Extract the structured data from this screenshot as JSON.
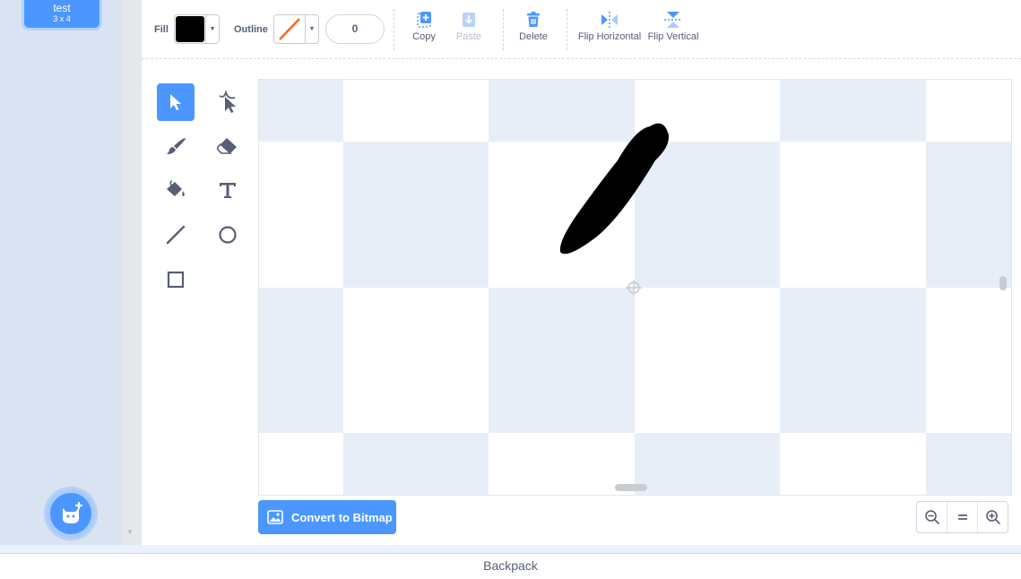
{
  "costume": {
    "name": "test",
    "size": "3 x 4"
  },
  "toolbar": {
    "fill_label": "Fill",
    "fill_color": "#000000",
    "outline_label": "Outline",
    "outline_width": "0",
    "copy_label": "Copy",
    "paste_label": "Paste",
    "delete_label": "Delete",
    "flip_horizontal_label": "Flip Horizontal",
    "flip_vertical_label": "Flip Vertical"
  },
  "tools": [
    "select",
    "reshape",
    "brush",
    "eraser",
    "fill",
    "text",
    "line",
    "circle",
    "rectangle"
  ],
  "active_tool": "select",
  "convert_label": "Convert to Bitmap",
  "backpack_label": "Backpack",
  "colors": {
    "accent": "#4c97ff",
    "text": "#575e75",
    "outline_none": "#ff661a"
  }
}
